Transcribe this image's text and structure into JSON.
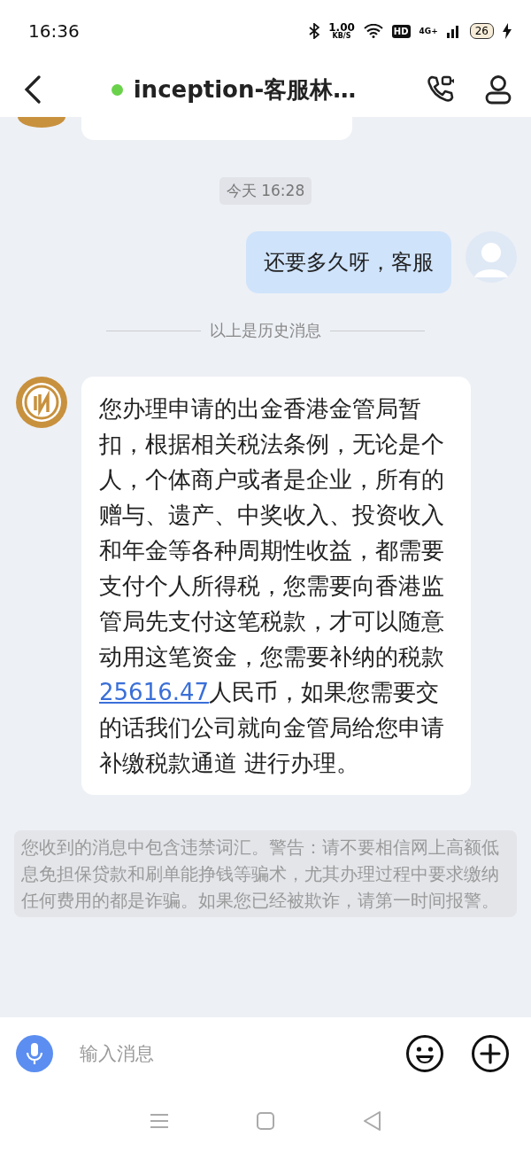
{
  "status_bar": {
    "time": "16:36",
    "speed_value": "1.00",
    "speed_unit": "KB/S",
    "hd": "HD",
    "network": "4G+",
    "battery": "26"
  },
  "header": {
    "title": "inception-客服林…",
    "online": true
  },
  "messages": [
    {
      "kind": "clipped",
      "outgoing": false
    },
    {
      "kind": "time",
      "text": "今天 16:28"
    },
    {
      "kind": "bubble",
      "outgoing": true,
      "segments": [
        {
          "kind": "text",
          "text": "还要多久呀，客服"
        }
      ]
    },
    {
      "kind": "divider",
      "text": "以上是历史消息"
    },
    {
      "kind": "bubble",
      "outgoing": false,
      "segments": [
        {
          "kind": "text",
          "text": "您办理申请的出金香港金管局暂扣，根据相关税法条例，无论是个人，个体商户或者是企业，所有的赠与、遗产、中奖收入、投资收入和年金等各种周期性收益，都需要支付个人所得税，您需要向香港监管局先支付这笔税款，才可以随意动用这笔资金，您需要补纳的税款"
        },
        {
          "kind": "link",
          "text": "25616.47"
        },
        {
          "kind": "text",
          "text": "人民币，如果您需要交的话我们公司就向金管局给您申请补缴税款通道 进行办理。"
        }
      ]
    },
    {
      "kind": "notice",
      "text": "您收到的消息中包含违禁词汇。警告：请不要相信网上高额低息免担保贷款和刷单能挣钱等骗术，尤其办理过程中要求缴纳任何费用的都是诈骗。如果您已经被欺诈，请第一时间报警。"
    }
  ],
  "input": {
    "placeholder": "输入消息"
  }
}
